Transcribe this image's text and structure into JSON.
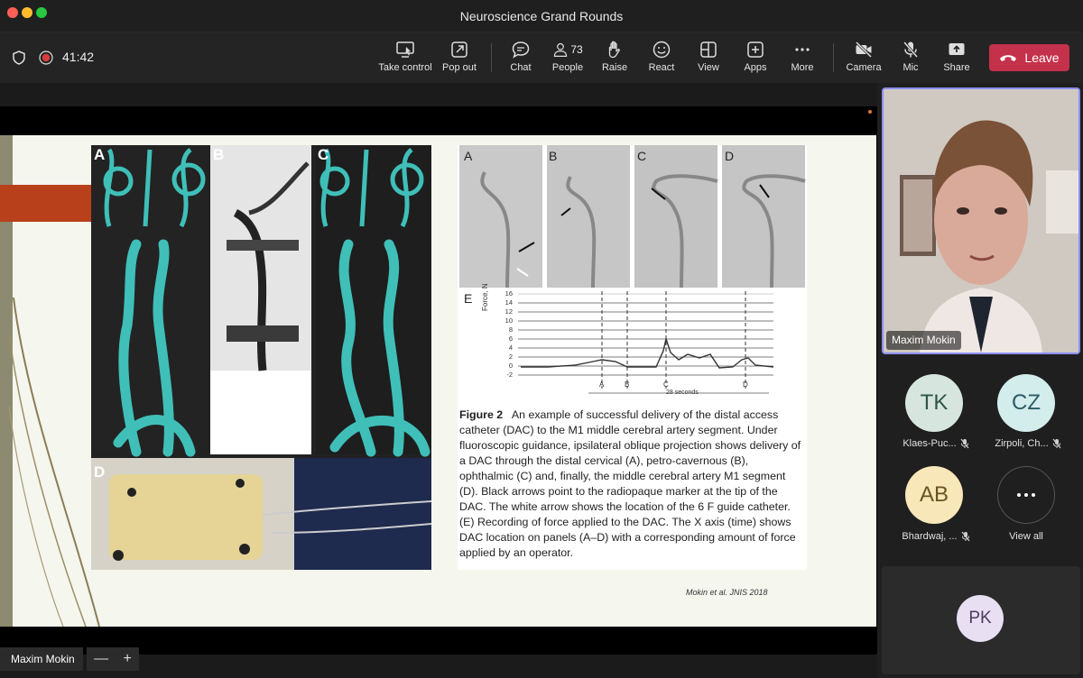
{
  "window": {
    "title": "Neuroscience Grand Rounds"
  },
  "meeting": {
    "timer": "41:42"
  },
  "toolbar": {
    "take_control": "Take control",
    "pop_out": "Pop out",
    "chat": "Chat",
    "people": "People",
    "people_count": "73",
    "raise": "Raise",
    "react": "React",
    "view": "View",
    "apps": "Apps",
    "more": "More",
    "camera": "Camera",
    "mic": "Mic",
    "share": "Share",
    "leave": "Leave"
  },
  "slide": {
    "left_labels": [
      "A",
      "B",
      "C",
      "D"
    ],
    "right_labels": [
      "A",
      "B",
      "C",
      "D",
      "E"
    ],
    "chart": {
      "ylabel": "Force, N",
      "yticks": [
        "16",
        "14",
        "12",
        "10",
        "8",
        "6",
        "4",
        "2",
        "0",
        "-2"
      ],
      "xticks": [
        "A",
        "B",
        "C",
        "D"
      ],
      "xnote": "28 seconds"
    },
    "caption_title": "Figure 2",
    "caption_body": "An example of successful delivery of the distal access catheter (DAC) to the M1 middle cerebral artery segment. Under fluoroscopic guidance, ipsilateral oblique projection shows delivery of a DAC through the distal cervical (A), petro-cavernous (B), ophthalmic (C) and, finally, the middle cerebral artery M1 segment (D). Black arrows point to the radiopaque marker at the tip of the DAC. The white arrow shows the location of the 6 F guide catheter. (E) Recording of force applied to the DAC. The X axis (time) shows DAC location on panels (A–D) with a corresponding amount of force applied by an operator.",
    "citation": "Mokin et al. JNIS 2018"
  },
  "presenter": {
    "name": "Maxim Mokin"
  },
  "zoom": {
    "minus": "—",
    "plus": "+"
  },
  "participants": [
    {
      "initials": "TK",
      "name": "Klaes-Puc...",
      "bg": "#d6e6de",
      "fg": "#2f5547"
    },
    {
      "initials": "CZ",
      "name": "Zirpoli, Ch...",
      "bg": "#d3ecec",
      "fg": "#2c5c63"
    },
    {
      "initials": "AB",
      "name": "Bhardwaj, ...",
      "bg": "#f7e7b9",
      "fg": "#6b5420"
    },
    {
      "view_all_label": "View all"
    }
  ],
  "bottom_participant": {
    "initials": "PK"
  },
  "colors": {
    "leave": "#c4314b",
    "active_border": "#8b8ef0",
    "slide_red": "#b8401b"
  }
}
